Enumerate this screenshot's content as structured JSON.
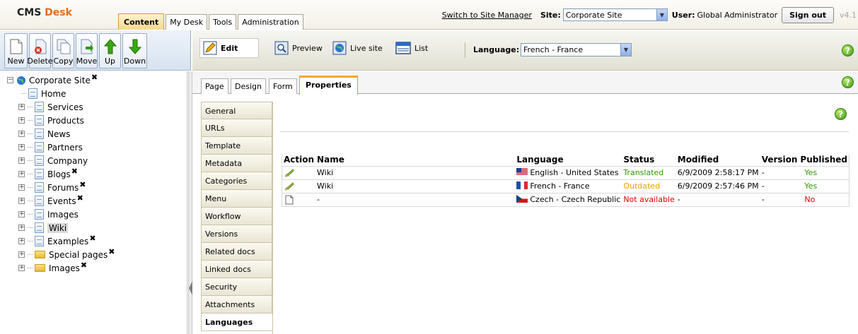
{
  "header": {
    "logo_cms": "CMS",
    "logo_desk": "Desk",
    "tabs": [
      {
        "label": "Content",
        "active": true
      },
      {
        "label": "My Desk",
        "active": false
      },
      {
        "label": "Tools",
        "active": false
      },
      {
        "label": "Administration",
        "active": false
      }
    ],
    "switch_link": "Switch to Site Manager",
    "site_label": "Site:",
    "site_value": "Corporate Site",
    "user_label": "User:",
    "user_value": "Global Administrator",
    "sign_out": "Sign out",
    "version": "v4.1"
  },
  "toolbar": {
    "new": "New",
    "delete": "Delete",
    "copy": "Copy",
    "move": "Move",
    "up": "Up",
    "down": "Down"
  },
  "view_toolbar": {
    "edit": "Edit",
    "preview": "Preview",
    "live_site": "Live site",
    "list": "List",
    "language_label": "Language:",
    "language_value": "French - France"
  },
  "tree": {
    "root": "Corporate Site",
    "items": [
      {
        "label": "Home",
        "expandable": false,
        "marked": false,
        "folder": false,
        "selected": false
      },
      {
        "label": "Services",
        "expandable": true,
        "marked": false,
        "folder": false,
        "selected": false
      },
      {
        "label": "Products",
        "expandable": true,
        "marked": false,
        "folder": false,
        "selected": false
      },
      {
        "label": "News",
        "expandable": true,
        "marked": false,
        "folder": false,
        "selected": false
      },
      {
        "label": "Partners",
        "expandable": true,
        "marked": false,
        "folder": false,
        "selected": false
      },
      {
        "label": "Company",
        "expandable": true,
        "marked": false,
        "folder": false,
        "selected": false
      },
      {
        "label": "Blogs",
        "expandable": true,
        "marked": true,
        "folder": false,
        "selected": false
      },
      {
        "label": "Forums",
        "expandable": true,
        "marked": true,
        "folder": false,
        "selected": false
      },
      {
        "label": "Events",
        "expandable": true,
        "marked": true,
        "folder": false,
        "selected": false
      },
      {
        "label": "Images",
        "expandable": true,
        "marked": false,
        "folder": false,
        "selected": false
      },
      {
        "label": "Wiki",
        "expandable": true,
        "marked": false,
        "folder": false,
        "selected": true
      },
      {
        "label": "Examples",
        "expandable": true,
        "marked": true,
        "folder": false,
        "selected": false
      },
      {
        "label": "Special pages",
        "expandable": true,
        "marked": true,
        "folder": true,
        "selected": false
      },
      {
        "label": "Images",
        "expandable": true,
        "marked": true,
        "folder": true,
        "selected": false
      }
    ]
  },
  "page_tabs": [
    {
      "label": "Page",
      "active": false
    },
    {
      "label": "Design",
      "active": false
    },
    {
      "label": "Form",
      "active": false
    },
    {
      "label": "Properties",
      "active": true
    }
  ],
  "property_tabs": [
    {
      "label": "General",
      "active": false
    },
    {
      "label": "URLs",
      "active": false
    },
    {
      "label": "Template",
      "active": false
    },
    {
      "label": "Metadata",
      "active": false
    },
    {
      "label": "Categories",
      "active": false
    },
    {
      "label": "Menu",
      "active": false
    },
    {
      "label": "Workflow",
      "active": false
    },
    {
      "label": "Versions",
      "active": false
    },
    {
      "label": "Related docs",
      "active": false
    },
    {
      "label": "Linked docs",
      "active": false
    },
    {
      "label": "Security",
      "active": false
    },
    {
      "label": "Attachments",
      "active": false
    },
    {
      "label": "Languages",
      "active": true
    }
  ],
  "languages_table": {
    "columns": [
      "Action",
      "Name",
      "Language",
      "Status",
      "Modified",
      "Version",
      "Published"
    ],
    "rows": [
      {
        "action_icon": "edit-icon",
        "name": "Wiki",
        "flag": "us",
        "language": "English - United States",
        "status": "Translated",
        "status_color": "#2e9a00",
        "modified": "6/9/2009 2:58:17 PM",
        "version": "-",
        "published": "Yes",
        "published_color": "#2e9a00"
      },
      {
        "action_icon": "edit-icon",
        "name": "Wiki",
        "flag": "fr",
        "language": "French - France",
        "status": "Outdated",
        "status_color": "#f0a000",
        "modified": "6/9/2009 2:57:46 PM",
        "version": "-",
        "published": "Yes",
        "published_color": "#2e9a00"
      },
      {
        "action_icon": "new-document-icon",
        "name": "-",
        "flag": "cz",
        "language": "Czech - Czech Republic",
        "status": "Not available",
        "status_color": "#e00000",
        "modified": "-",
        "version": "-",
        "published": "No",
        "published_color": "#e00000"
      }
    ]
  }
}
